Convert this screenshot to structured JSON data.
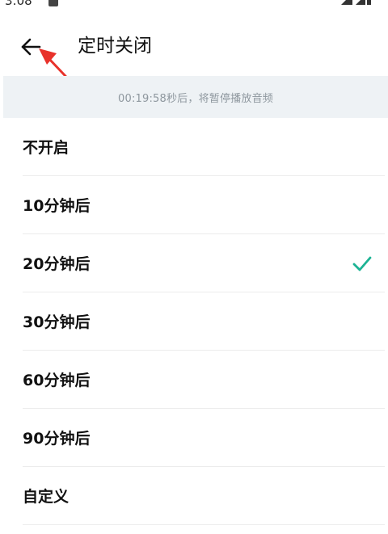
{
  "status_bar": {
    "time": "3:08"
  },
  "header": {
    "back_icon": "arrow-left-icon",
    "title": "定时关闭"
  },
  "banner": {
    "text": "00:19:58秒后，将暂停播放音频"
  },
  "options": [
    {
      "label": "不开启",
      "selected": false
    },
    {
      "label": "10分钟后",
      "selected": false
    },
    {
      "label": "20分钟后",
      "selected": true
    },
    {
      "label": "30分钟后",
      "selected": false
    },
    {
      "label": "60分钟后",
      "selected": false
    },
    {
      "label": "90分钟后",
      "selected": false
    },
    {
      "label": "自定义",
      "selected": false
    }
  ],
  "colors": {
    "accent_check": "#1cb394",
    "annotation_arrow": "#e8322b",
    "banner_bg": "#eef2f5",
    "banner_text": "#8e979e"
  }
}
